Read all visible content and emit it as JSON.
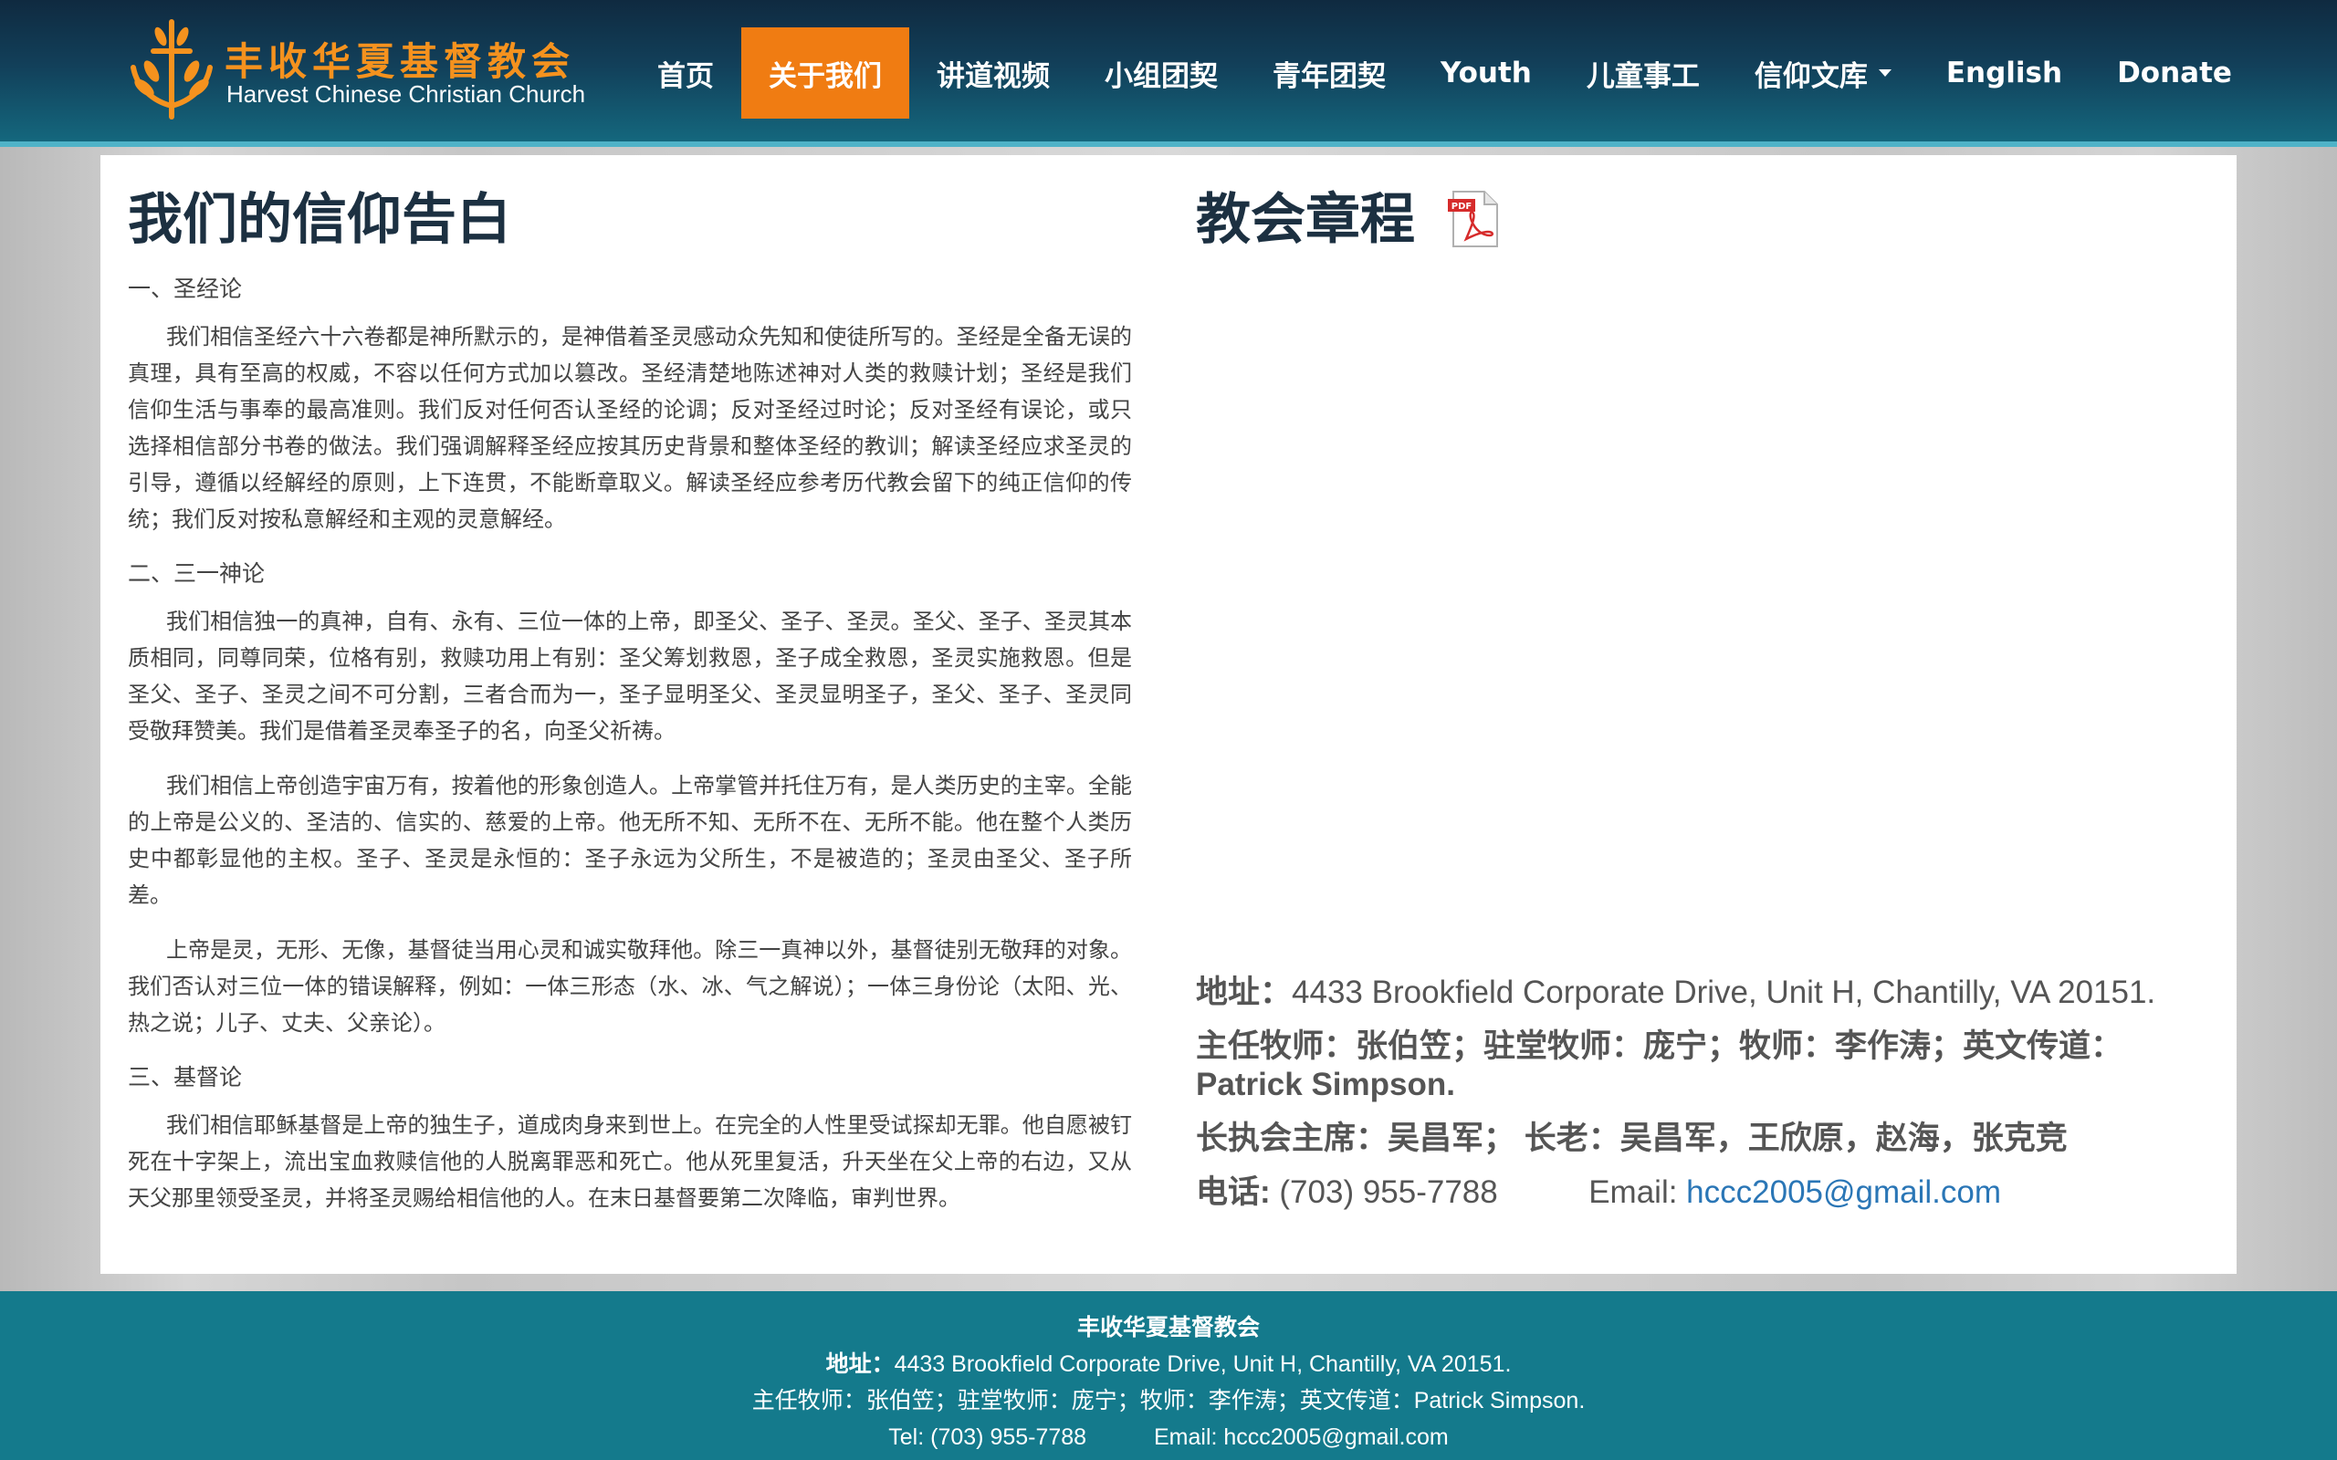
{
  "brand": {
    "name_cn": "丰收华夏基督教会",
    "name_en": "Harvest Chinese Christian Church",
    "colors": {
      "orange": "#f07c12",
      "header_dark": "#0f2a40",
      "teal": "#147a8c"
    }
  },
  "nav": {
    "items": [
      {
        "label": "首页"
      },
      {
        "label": "关于我们",
        "active": true
      },
      {
        "label": "讲道视频"
      },
      {
        "label": "小组团契"
      },
      {
        "label": "青年团契"
      },
      {
        "label": "Youth"
      },
      {
        "label": "儿童事工"
      },
      {
        "label": "信仰文库",
        "dropdown": true
      },
      {
        "label": "English"
      },
      {
        "label": "Donate"
      }
    ]
  },
  "main": {
    "faith_title": "我们的信仰告白",
    "sections": [
      {
        "heading": "一、圣经论",
        "paragraphs": [
          "我们相信圣经六十六卷都是神所默示的，是神借着圣灵感动众先知和使徒所写的。圣经是全备无误的真理，具有至高的权威，不容以任何方式加以篡改。圣经清楚地陈述神对人类的救赎计划；圣经是我们信仰生活与事奉的最高准则。我们反对任何否认圣经的论调；反对圣经过时论；反对圣经有误论，或只选择相信部分书卷的做法。我们强调解释圣经应按其历史背景和整体圣经的教训；解读圣经应求圣灵的引导，遵循以经解经的原则，上下连贯，不能断章取义。解读圣经应参考历代教会留下的纯正信仰的传统；我们反对按私意解经和主观的灵意解经。"
        ]
      },
      {
        "heading": "二、三一神论",
        "paragraphs": [
          "我们相信独一的真神，自有、永有、三位一体的上帝，即圣父、圣子、圣灵。圣父、圣子、圣灵其本质相同，同尊同荣，位格有别，救赎功用上有别：圣父筹划救恩，圣子成全救恩，圣灵实施救恩。但是圣父、圣子、圣灵之间不可分割，三者合而为一，圣子显明圣父、圣灵显明圣子，圣父、圣子、圣灵同受敬拜赞美。我们是借着圣灵奉圣子的名，向圣父祈祷。",
          "我们相信上帝创造宇宙万有，按着他的形象创造人。上帝掌管并托住万有，是人类历史的主宰。全能的上帝是公义的、圣洁的、信实的、慈爱的上帝。他无所不知、无所不在、无所不能。他在整个人类历史中都彰显他的主权。圣子、圣灵是永恒的：圣子永远为父所生，不是被造的；圣灵由圣父、圣子所差。",
          "上帝是灵，无形、无像，基督徒当用心灵和诚实敬拜他。除三一真神以外，基督徒别无敬拜的对象。我们否认对三位一体的错误解释，例如：一体三形态（水、冰、气之解说）；一体三身份论（太阳、光、热之说；儿子、丈夫、父亲论）。"
        ]
      },
      {
        "heading": "三、基督论",
        "paragraphs": [
          "我们相信耶稣基督是上帝的独生子，道成肉身来到世上。在完全的人性里受试探却无罪。他自愿被钉死在十字架上，流出宝血救赎信他的人脱离罪恶和死亡。他从死里复活，升天坐在父上帝的右边，又从天父那里领受圣灵，并将圣灵赐给相信他的人。在末日基督要第二次降临，审判世界。"
        ]
      }
    ],
    "bylaws_title": "教会章程",
    "pdf_icon_label": "PDF",
    "contact": {
      "address_label": "地址：",
      "address": "4433 Brookfield Corporate Drive, Unit H, Chantilly, VA 20151.",
      "pastors": "主任牧师：张伯笠；驻堂牧师：庞宁；牧师：李作涛；英文传道：Patrick Simpson.",
      "board": "长执会主席：吴昌军； 长老：吴昌军，王欣原，赵海，张克竞",
      "phone_label": "电话: ",
      "phone": "(703) 955-7788",
      "email_label": "Email: ",
      "email": "hccc2005@gmail.com"
    }
  },
  "footer": {
    "title": "丰收华夏基督教会",
    "address_label": "地址：",
    "address": "4433 Brookfield Corporate Drive, Unit H, Chantilly, VA 20151.",
    "pastors": "主任牧师：张伯笠；驻堂牧师：庞宁；牧师：李作涛；英文传道：Patrick Simpson.",
    "phone": "Tel: (703) 955-7788",
    "email": "Email: hccc2005@gmail.com"
  }
}
